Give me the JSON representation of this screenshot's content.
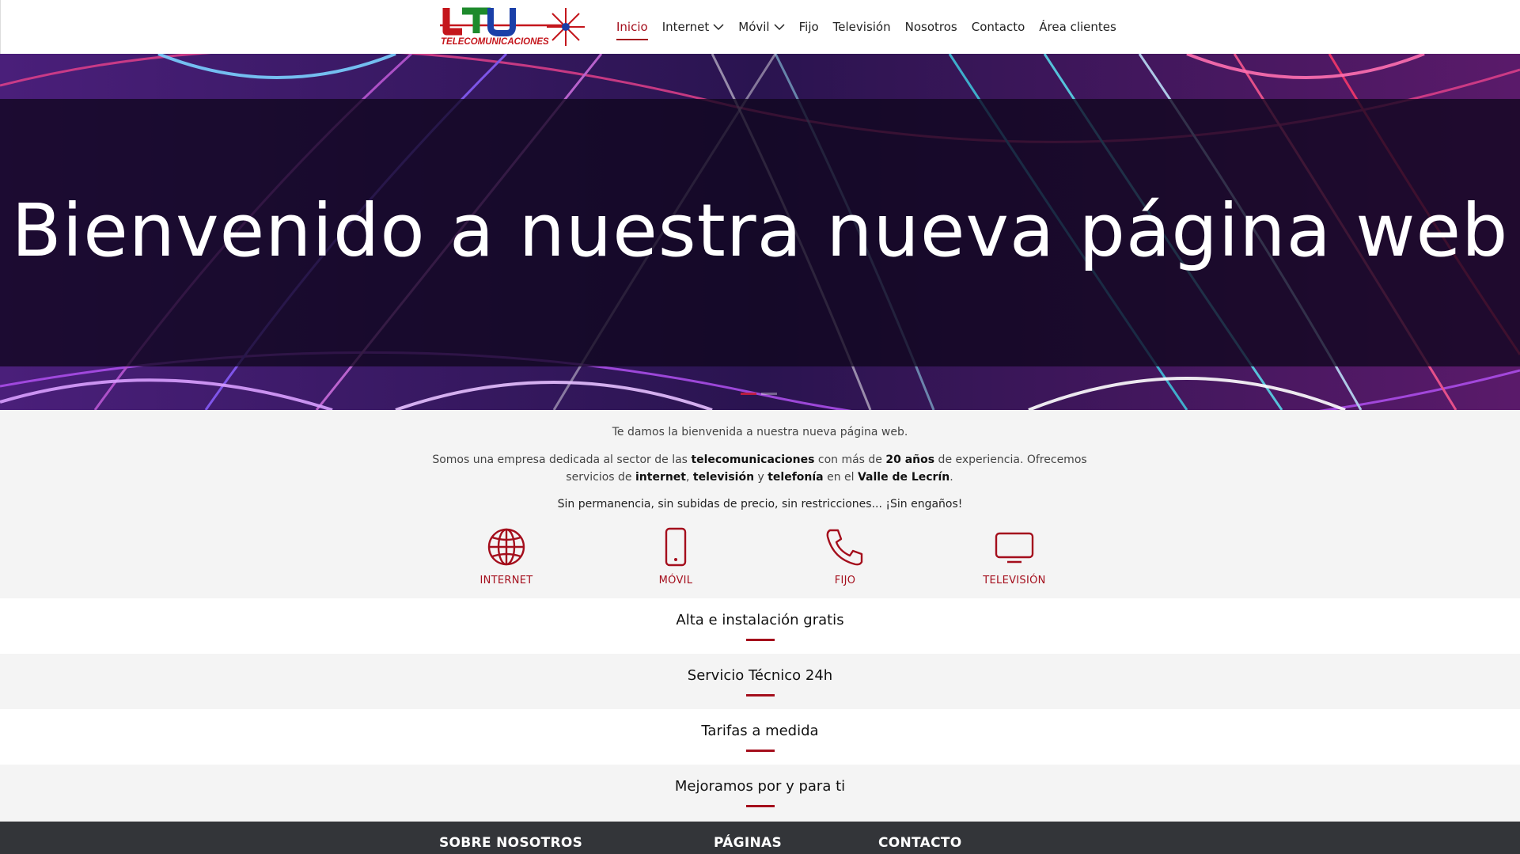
{
  "brand": {
    "logo_letters": "LTU",
    "logo_subtitle": "TELECOMUNICACIONES",
    "colors": {
      "accent": "#a40e1c",
      "logo_green": "#1e8a2c",
      "logo_blue": "#1a3fa8",
      "logo_red": "#c4161c"
    }
  },
  "nav": {
    "items": [
      {
        "label": "Inicio",
        "active": true
      },
      {
        "label": "Internet",
        "dropdown": true
      },
      {
        "label": "Móvil",
        "dropdown": true
      },
      {
        "label": "Fijo"
      },
      {
        "label": "Televisión"
      },
      {
        "label": "Nosotros"
      },
      {
        "label": "Contacto"
      },
      {
        "label": "Área clientes"
      }
    ]
  },
  "hero": {
    "title": "Bienvenido a nuestra nueva página web",
    "slides": 2,
    "active_slide": 1
  },
  "intro": {
    "line1": "Te damos la bienvenida a nuestra nueva página web.",
    "line2_parts": [
      {
        "t": "Somos una empresa dedicada al sector de las ",
        "b": false
      },
      {
        "t": "telecomunicaciones",
        "b": true
      },
      {
        "t": " con más de ",
        "b": false
      },
      {
        "t": "20 años",
        "b": true
      },
      {
        "t": " de experiencia. Ofrecemos servicios de ",
        "b": false
      },
      {
        "t": "internet",
        "b": true
      },
      {
        "t": ", ",
        "b": false
      },
      {
        "t": "televisión",
        "b": true
      },
      {
        "t": " y ",
        "b": false
      },
      {
        "t": "telefonía",
        "b": true
      },
      {
        "t": " en el ",
        "b": false
      },
      {
        "t": "Valle de Lecrín",
        "b": true
      },
      {
        "t": ".",
        "b": false
      }
    ],
    "line3": "Sin permanencia, sin subidas de precio, sin restricciones... ¡Sin engaños!"
  },
  "services": [
    {
      "label": "INTERNET",
      "icon": "globe-icon"
    },
    {
      "label": "MÓVIL",
      "icon": "mobile-phone-icon"
    },
    {
      "label": "FIJO",
      "icon": "phone-handset-icon"
    },
    {
      "label": "TELEVISIÓN",
      "icon": "tv-icon"
    }
  ],
  "features": [
    {
      "label": "Alta e instalación gratis"
    },
    {
      "label": "Servicio Técnico 24h"
    },
    {
      "label": "Tarifas a medida"
    },
    {
      "label": "Mejoramos por y para ti"
    }
  ],
  "footer": {
    "headings": [
      "SOBRE NOSOTROS",
      "PÁGINAS",
      "CONTACTO"
    ]
  }
}
